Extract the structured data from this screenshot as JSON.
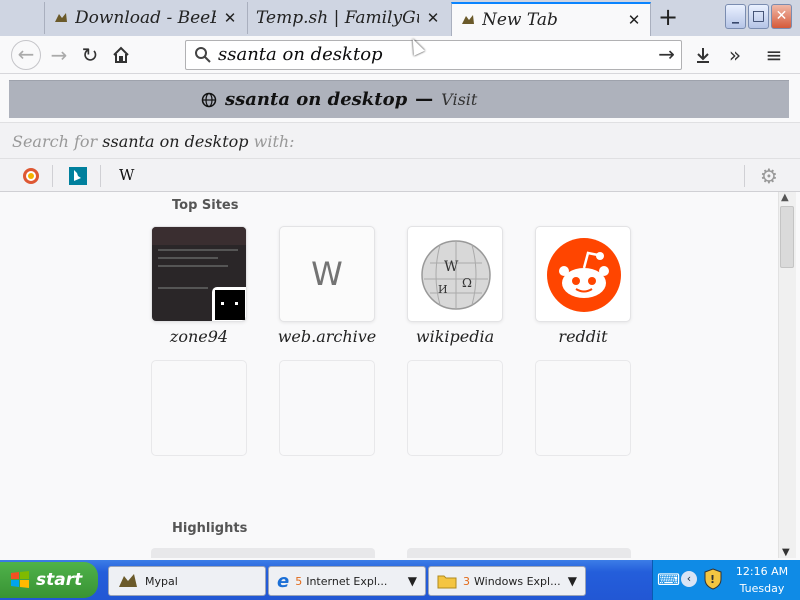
{
  "tabs": [
    {
      "title": "Download - BeeBE",
      "active": false
    },
    {
      "title": "Temp.sh | FamilyGuyS",
      "active": false
    },
    {
      "title": "New Tab",
      "active": true
    }
  ],
  "toolbar": {
    "url": "ssanta on desktop"
  },
  "suggestion": {
    "text": "ssanta on desktop",
    "dash": "—",
    "action": "Visit"
  },
  "search_with": {
    "prefix": "Search for",
    "query": "ssanta on desktop",
    "suffix": "with:"
  },
  "engines": [
    {
      "name": "duckduckgo-icon"
    },
    {
      "name": "bing-icon"
    },
    {
      "name": "wikipedia-icon",
      "glyph": "W"
    }
  ],
  "top_sites": {
    "title": "Top Sites",
    "tiles": [
      {
        "label": "zone94",
        "kind": "screenshot"
      },
      {
        "label": "web.archive",
        "kind": "letter",
        "letter": "W"
      },
      {
        "label": "wikipedia",
        "kind": "globe"
      },
      {
        "label": "reddit",
        "kind": "reddit"
      }
    ]
  },
  "highlights": {
    "title": "Highlights"
  },
  "taskbar": {
    "start": "start",
    "tasks": [
      {
        "label": "Mypal",
        "count": ""
      },
      {
        "label": "Internet Expl...",
        "count": "5"
      },
      {
        "label": "Windows Expl...",
        "count": "3"
      }
    ],
    "time": "12:16 AM",
    "day": "Tuesday"
  },
  "colors": {
    "accent": "#0a84ff",
    "reddit": "#ff4500",
    "taskbar": "#245edb",
    "start": "#399334"
  }
}
